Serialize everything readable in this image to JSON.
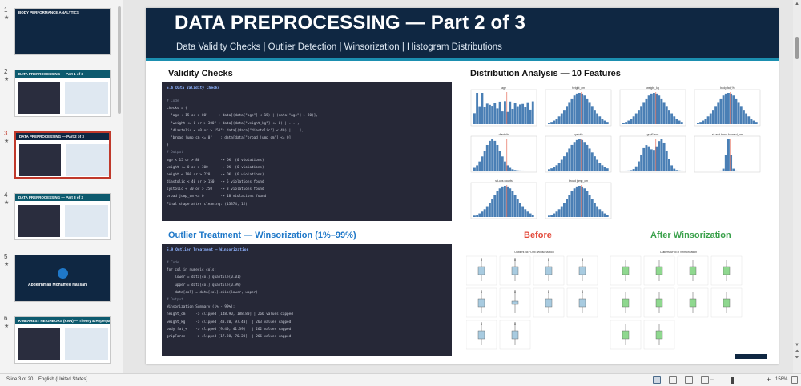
{
  "thumbnails": [
    {
      "num": "1",
      "title": "BODY PERFORMANCE ANALYTICS",
      "style": "navy",
      "active": false
    },
    {
      "num": "2",
      "title": "DATA PREPROCESSING — Part 1 of 3",
      "style": "teal",
      "active": false
    },
    {
      "num": "3",
      "title": "DATA PREPROCESSING — Part 2 of 3",
      "style": "dark",
      "active": true
    },
    {
      "num": "4",
      "title": "DATA PREPROCESSING — Part 3 of 3",
      "style": "teal",
      "active": false
    },
    {
      "num": "5",
      "title": "Abdelrhman Mohamed Hassan",
      "style": "navy",
      "active": false
    },
    {
      "num": "6",
      "title": "K-NEAREST NEIGHBORS (KNN) — Theory & Hyperparameter Tuning",
      "style": "teal",
      "active": false
    }
  ],
  "slide": {
    "title": "DATA PREPROCESSING — Part 2 of 3",
    "subtitle": "Data Validity Checks  |  Outlier Detection  |  Winsorization  |  Histogram Distributions",
    "validity_title": "Validity Checks",
    "distribution_title": "Distribution Analysis — 10 Features",
    "outlier_title": "Outlier Treatment — Winsorization (1%–99%)",
    "before_title": "Before",
    "after_title": "After Winsorization",
    "code1": {
      "header": "5.6 Data Validity Checks",
      "lines": [
        {
          "t": "# Code",
          "c": true
        },
        {
          "t": "checks = {",
          "c": false
        },
        {
          "t": "  \"age < 15 or > 80\"     : data[(data[\"age\"] < 15) | (data[\"age\"] > 80)],",
          "c": false
        },
        {
          "t": "  \"weight <= 0 or > 300\" : data[(data[\"weight_kg\"] <= 0) | ...],",
          "c": false
        },
        {
          "t": "  \"diastolic < 40 or > 150\": data[(data[\"diastolic\"] < 40) | ...],",
          "c": false
        },
        {
          "t": "  \"broad jump_cm <= 0\"    : data[data[\"broad jump_cm\"] <= 0],",
          "c": false
        },
        {
          "t": "}",
          "c": false
        },
        {
          "t": "# Output",
          "c": true
        },
        {
          "t": "age < 15 or > 80          -> OK  (0 violations)",
          "c": false
        },
        {
          "t": "weight <= 0 or > 300      -> OK  (0 violations)",
          "c": false
        },
        {
          "t": "height < 100 or > 220     -> OK  (0 violations)",
          "c": false
        },
        {
          "t": "diastolic < 40 or > 150   -> 5 violations found",
          "c": false
        },
        {
          "t": "systolic < 70 or > 250    -> 3 violations found",
          "c": false
        },
        {
          "t": "broad jump_cm <= 0        -> 18 violations found",
          "c": false
        },
        {
          "t": "Final shape after cleaning: (13374, 12)",
          "c": false
        }
      ]
    },
    "code2": {
      "header": "5.9 Outlier Treatment — Winsorization",
      "lines": [
        {
          "t": "# Code",
          "c": true
        },
        {
          "t": "for col in numeric_cols:",
          "c": false
        },
        {
          "t": "    lower = data[col].quantile(0.01)",
          "c": false
        },
        {
          "t": "    upper = data[col].quantile(0.99)",
          "c": false
        },
        {
          "t": "    data[col] = data[col].clip(lower, upper)",
          "c": false
        },
        {
          "t": "# Output",
          "c": true
        },
        {
          "t": "Winsorization Summary (1% - 99%):",
          "c": false
        },
        {
          "t": "height_cm     -> clipped [148.90, 188.80] | 266 values capped",
          "c": false
        },
        {
          "t": "weight_kg     -> clipped [43.20, 97.40]  | 263 values capped",
          "c": false
        },
        {
          "t": "body fat_%    -> clipped [9.40, 41.39]   | 262 values capped",
          "c": false
        },
        {
          "t": "gripForce     -> clipped [17.28, 70.23]  | 266 values capped",
          "c": false
        }
      ]
    },
    "hist_labels": [
      "age",
      "height_cm",
      "weight_kg",
      "body fat_%",
      "diastolic",
      "systolic",
      "gripForce",
      "sit and bend forward_cm",
      "sit-ups counts",
      "broad jump_cm"
    ],
    "box_before_title": "Outliers BEFORE Winsorization",
    "box_after_title": "Outliers AFTER Winsorization"
  },
  "status": {
    "slide_of": "Slide 3 of 20",
    "language": "English (United States)",
    "zoom": "158%"
  },
  "colors": {
    "header": "#0f2742",
    "hist_bar": "#4a7fb5",
    "box_before": "#a8cbe0",
    "box_after": "#8fd88f"
  }
}
